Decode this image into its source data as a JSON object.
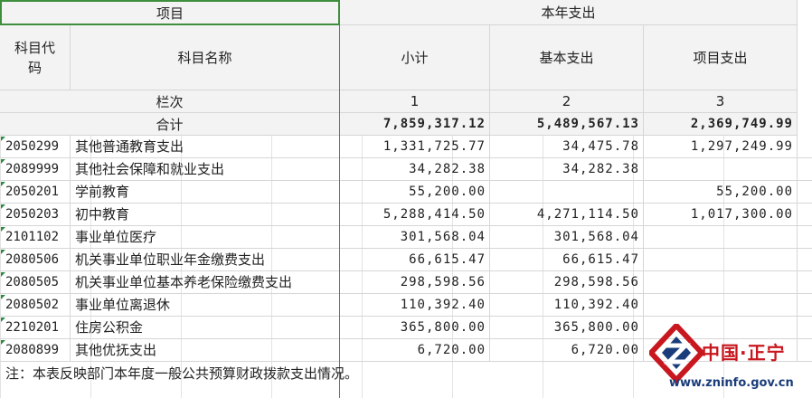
{
  "header": {
    "project": "项目",
    "year_spend": "本年支出",
    "code_label": "科目代码",
    "name_label": "科目名称",
    "subtotal": "小计",
    "basic": "基本支出",
    "project_spend": "项目支出"
  },
  "column_row": {
    "label": "栏次",
    "c1": "1",
    "c2": "2",
    "c3": "3"
  },
  "total_row": {
    "label": "合计",
    "subtotal": "7,859,317.12",
    "basic": "5,489,567.13",
    "project": "2,369,749.99"
  },
  "rows": [
    {
      "code": "2050299",
      "name": "其他普通教育支出",
      "subtotal": "1,331,725.77",
      "basic": "34,475.78",
      "project": "1,297,249.99"
    },
    {
      "code": "2089999",
      "name": "其他社会保障和就业支出",
      "subtotal": "34,282.38",
      "basic": "34,282.38",
      "project": ""
    },
    {
      "code": "2050201",
      "name": "学前教育",
      "subtotal": "55,200.00",
      "basic": "",
      "project": "55,200.00"
    },
    {
      "code": "2050203",
      "name": "初中教育",
      "subtotal": "5,288,414.50",
      "basic": "4,271,114.50",
      "project": "1,017,300.00"
    },
    {
      "code": "2101102",
      "name": "事业单位医疗",
      "subtotal": "301,568.04",
      "basic": "301,568.04",
      "project": ""
    },
    {
      "code": "2080506",
      "name": "机关事业单位职业年金缴费支出",
      "subtotal": "66,615.47",
      "basic": "66,615.47",
      "project": ""
    },
    {
      "code": "2080505",
      "name": "机关事业单位基本养老保险缴费支出",
      "subtotal": "298,598.56",
      "basic": "298,598.56",
      "project": ""
    },
    {
      "code": "2080502",
      "name": "事业单位离退休",
      "subtotal": "110,392.40",
      "basic": "110,392.40",
      "project": ""
    },
    {
      "code": "2210201",
      "name": "住房公积金",
      "subtotal": "365,800.00",
      "basic": "365,800.00",
      "project": ""
    },
    {
      "code": "2080899",
      "name": "其他优抚支出",
      "subtotal": "6,720.00",
      "basic": "6,720.00",
      "project": ""
    }
  ],
  "note": "注：本表反映部门本年度一般公共预算财政拨款支出情况。",
  "logo": {
    "title": "中国·正宁",
    "url": "www.zninfo.gov.cn"
  },
  "colors": {
    "selection": "#3e8e3e",
    "header_bg": "#f3f3f3",
    "logo_red": "#c8171e",
    "logo_blue": "#1a3c7a"
  }
}
